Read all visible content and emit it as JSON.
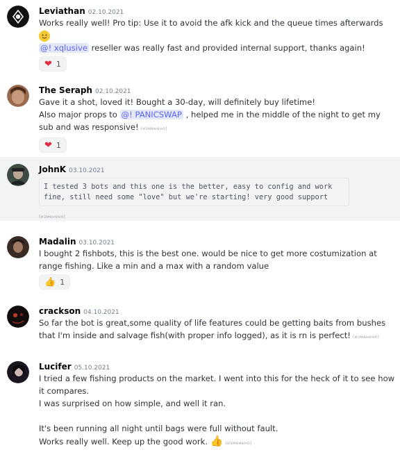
{
  "messages": [
    {
      "username": "Leviathan",
      "timestamp": "02.10.2021",
      "lines": [
        "Works really well! Pro tip: Use it to avoid the afk kick and the queue times afterwards"
      ],
      "emoji_line": "🙂",
      "mention": "@! xqlusive",
      "mention_rest": " reseller was really fast and provided internal support, thanks again!",
      "reaction": {
        "emoji": "❤",
        "count": "1"
      }
    },
    {
      "username": "The Seraph",
      "timestamp": "02.10.2021",
      "line1": "Gave it a shot, loved it! Bought a 30-day, will definitely buy lifetime!",
      "line2_pre": "Also major props to ",
      "mention": "@! PANICSWAP",
      "line2_post": " , helped me in the middle of the night to get my",
      "line3": "sub and was responsive!",
      "edited": "(изменено)",
      "reaction": {
        "emoji": "❤",
        "count": "1"
      }
    },
    {
      "username": "JohnK",
      "timestamp": "03.10.2021",
      "code_line1": "I tested 3 bots and this one is the better, easy to config and work",
      "code_line2": "fine, still need some \"love\" but we're starting! very good support",
      "edited": "(изменено)"
    },
    {
      "username": "Madalin",
      "timestamp": "03.10.2021",
      "line1": "I bought 2 fishbots, this is the best one. would be nice to get more costumization at",
      "line2": "range fishing. Like a min and a max with a random value",
      "reaction": {
        "emoji": "👍",
        "count": "1"
      }
    },
    {
      "username": "crackson",
      "timestamp": "04.10.2021",
      "line1": "So far the bot is great,some quality of life features could be getting baits from bushes",
      "line2": "that I'm inside and salvage fish(with proper info logged), as it is rn is perfect!",
      "edited": "(изменено)"
    },
    {
      "username": "Lucifer",
      "timestamp": "05.10.2021",
      "line1": "I tried a few fishing products on the market. I went into this for the heck of it to see how",
      "line2": "it compares.",
      "line3": "I was surprised on how simple, and well it ran.",
      "line4": "It's been running all night until bags were full without fault.",
      "line5": "Works really well. Keep up the good work.",
      "emoji": "👍",
      "edited": "(изменено)"
    }
  ]
}
